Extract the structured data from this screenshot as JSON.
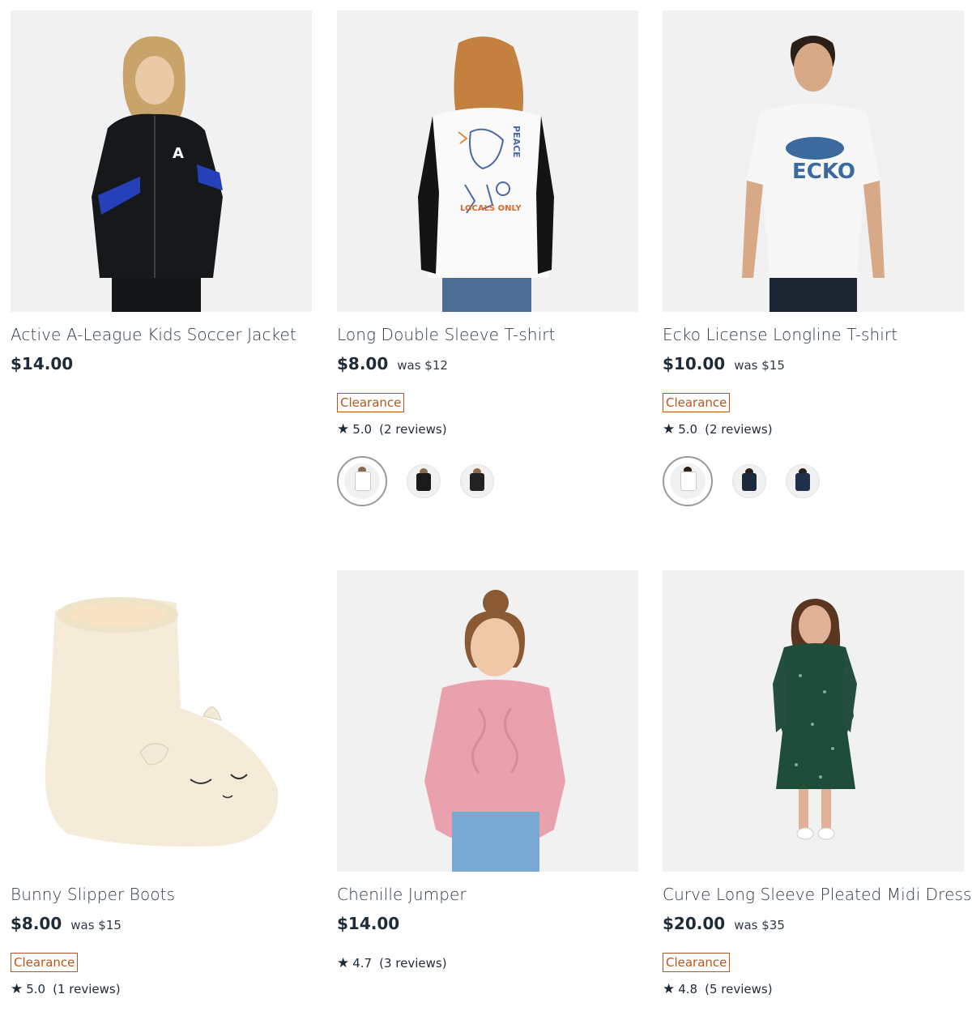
{
  "products": [
    {
      "title": "Active A-League Kids Soccer Jacket",
      "price": "$14.00"
    },
    {
      "title": "Long Double Sleeve T-shirt",
      "price": "$8.00",
      "was": "was $12",
      "badge": "Clearance",
      "rating": "5.0",
      "reviews": "(2 reviews)"
    },
    {
      "title": "Ecko License Longline T-shirt",
      "price": "$10.00",
      "was": "was $15",
      "badge": "Clearance",
      "rating": "5.0",
      "reviews": "(2 reviews)"
    },
    {
      "title": "Bunny Slipper Boots",
      "price": "$8.00",
      "was": "was $15",
      "badge": "Clearance",
      "rating": "5.0",
      "reviews": "(1 reviews)"
    },
    {
      "title": "Chenille Jumper",
      "price": "$14.00",
      "rating": "4.7",
      "reviews": "(3 reviews)"
    },
    {
      "title": "Curve Long Sleeve Pleated Midi Dress",
      "price": "$20.00",
      "was": "was $35",
      "badge": "Clearance",
      "rating": "4.8",
      "reviews": "(5 reviews)"
    }
  ],
  "img_text": {
    "peace": "PEACE",
    "locals_only": "LOCALS ONLY",
    "ecko": "ECKO"
  },
  "colors": {
    "clearance": "#b5561d",
    "text": "#1f2b36",
    "image_bg": "#f0f0f0"
  },
  "icons": {
    "rating": "star-icon"
  }
}
